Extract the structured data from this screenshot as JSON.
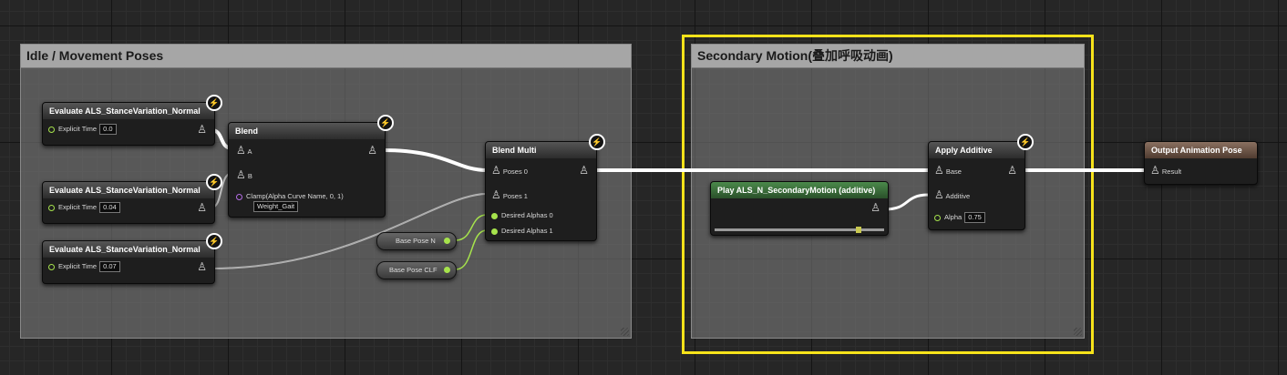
{
  "comments": {
    "idle": "Idle / Movement Poses",
    "secondary": "Secondary Motion(叠加呼吸动画)"
  },
  "nodes": {
    "eval1": {
      "title": "Evaluate ALS_StanceVariation_Normal",
      "pin_label": "Explicit Time",
      "value": "0.0"
    },
    "eval2": {
      "title": "Evaluate ALS_StanceVariation_Normal",
      "pin_label": "Explicit Time",
      "value": "0.04"
    },
    "eval3": {
      "title": "Evaluate ALS_StanceVariation_Normal",
      "pin_label": "Explicit Time",
      "value": "0.07"
    },
    "blend": {
      "title": "Blend",
      "pin_a": "A",
      "pin_b": "B",
      "clamp": "Clamp(Alpha Curve Name, 0, 1)",
      "curve": "Weight_Gait"
    },
    "blend_multi": {
      "title": "Blend Multi",
      "poses0": "Poses 0",
      "poses1": "Poses 1",
      "alpha0": "Desired Alphas 0",
      "alpha1": "Desired Alphas 1"
    },
    "var_n": "Base Pose N",
    "var_clf": "Base Pose CLF",
    "play": {
      "title": "Play ALS_N_SecondaryMotion (additive)"
    },
    "apply_additive": {
      "title": "Apply Additive",
      "base": "Base",
      "additive": "Additive",
      "alpha": "Alpha",
      "alpha_value": "0.75"
    },
    "output": {
      "title": "Output Animation Pose",
      "result": "Result"
    }
  },
  "icons": {
    "fast_path": "⚡",
    "pose_pin": "pose-figure"
  },
  "colors": {
    "selection": "#f6e21a",
    "float_pin": "#a6e34c",
    "name_pin": "#b46ee6",
    "exec_wire": "#ffffff"
  }
}
